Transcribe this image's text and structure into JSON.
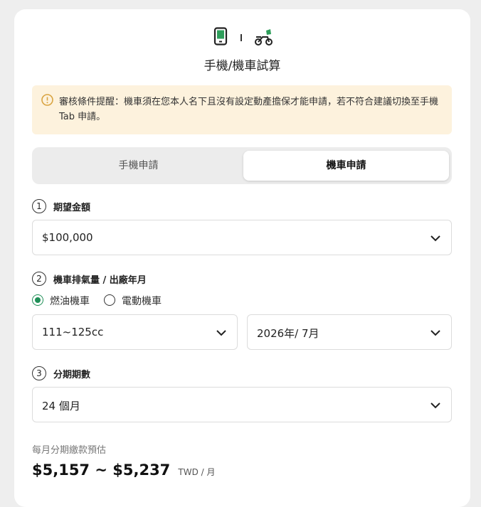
{
  "header": {
    "title": "手機/機車試算"
  },
  "notice": {
    "text": "審核條件提醒：機車須在您本人名下且沒有設定動產擔保才能申請，若不符合建議切換至手機 Tab 申請。"
  },
  "tabs": [
    {
      "label": "手機申請",
      "active": false
    },
    {
      "label": "機車申請",
      "active": true
    }
  ],
  "step1": {
    "num": "1",
    "label": "期望金額",
    "value": "$100,000"
  },
  "step2": {
    "num": "2",
    "label": "機車排氣量 / 出廠年月",
    "radios": [
      {
        "label": "燃油機車",
        "checked": true
      },
      {
        "label": "電動機車",
        "checked": false
      }
    ],
    "displacement": "111~125cc",
    "date": "2026年/ 7月"
  },
  "step3": {
    "num": "3",
    "label": "分期期數",
    "value": "24 個月"
  },
  "estimate": {
    "label": "每月分期繳款預估",
    "range": "$5,157 ~ $5,237",
    "unit": "TWD / 月"
  },
  "colors": {
    "accent": "#1f8f57",
    "notice_bg": "#fdf2dd",
    "notice_icon": "#d9a441"
  }
}
